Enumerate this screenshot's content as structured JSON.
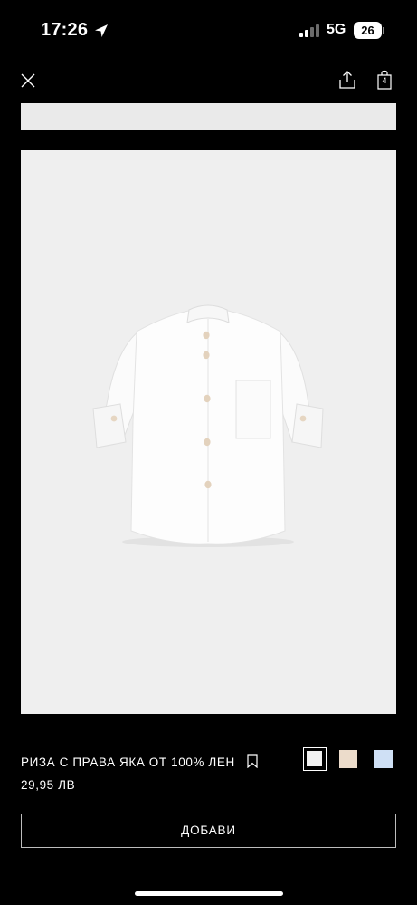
{
  "status_bar": {
    "time": "17:26",
    "network": "5G",
    "battery": "26"
  },
  "nav": {
    "bag_count": "4",
    "icons": [
      "close-icon",
      "share-icon",
      "shopping-bag-icon"
    ]
  },
  "product": {
    "name": "РИЗА С ПРАВА ЯКА ОТ 100% ЛЕН",
    "price": "29,95 ЛВ",
    "add_button_label": "ДОБАВИ",
    "colors": [
      {
        "name": "white",
        "hex": "#f2f2f2",
        "selected": true
      },
      {
        "name": "beige",
        "hex": "#ecdccb",
        "selected": false
      },
      {
        "name": "light-blue",
        "hex": "#cfe0f5",
        "selected": false
      }
    ]
  }
}
